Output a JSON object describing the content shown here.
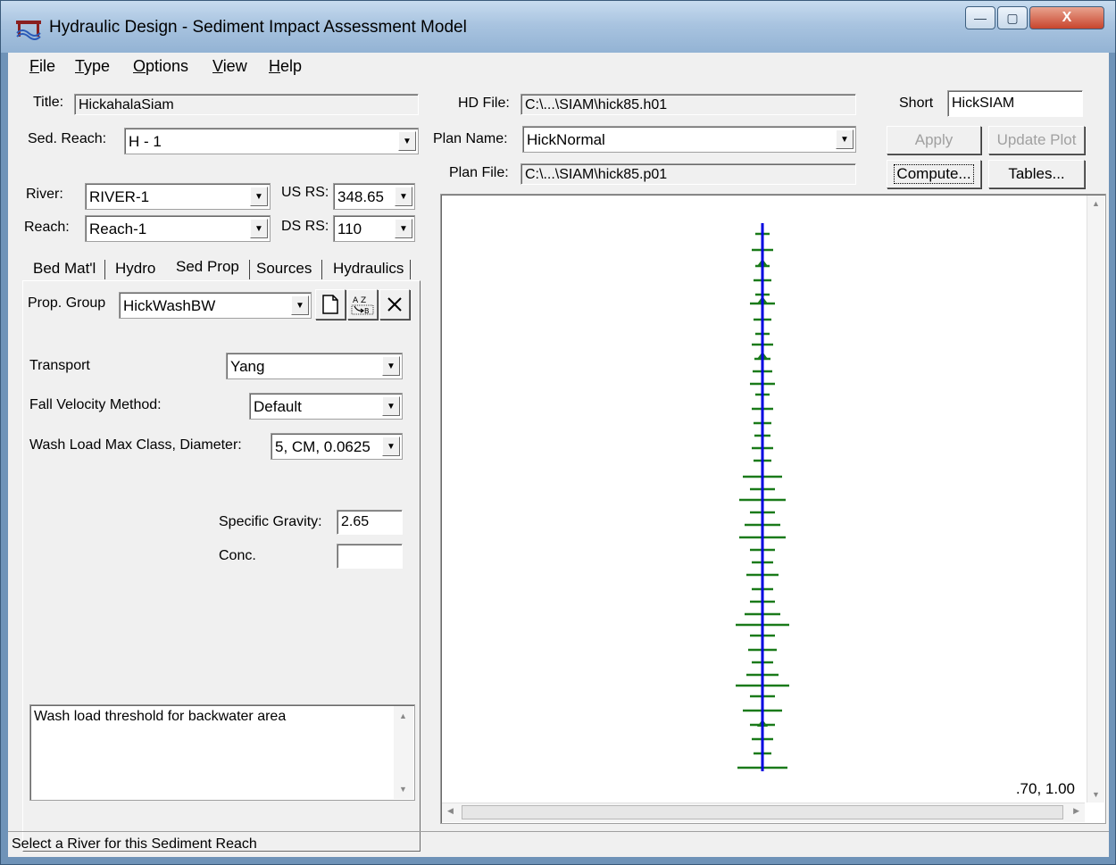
{
  "window": {
    "title": "Hydraulic Design - Sediment Impact Assessment Model",
    "minimize_label": "—",
    "maximize_label": "▢",
    "close_label": "X"
  },
  "menu": {
    "file": {
      "key": "F",
      "rest": "ile"
    },
    "type": {
      "key": "T",
      "rest": "ype"
    },
    "options": {
      "key": "O",
      "rest": "ptions"
    },
    "view": {
      "key": "V",
      "rest": "iew"
    },
    "help": {
      "key": "H",
      "rest": "elp"
    }
  },
  "form": {
    "title_label": "Title:",
    "title_value": "HickahalaSiam",
    "sed_reach_label": "Sed. Reach:",
    "sed_reach_value": "H - 1",
    "river_label": "River:",
    "river_value": "RIVER-1",
    "reach_label": "Reach:",
    "reach_value": "Reach-1",
    "us_rs_label": "US RS:",
    "us_rs_value": "348.65",
    "ds_rs_label": "DS RS:",
    "ds_rs_value": "110",
    "hd_file_label": "HD File:",
    "hd_file_value": "C:\\...\\SIAM\\hick85.h01",
    "plan_name_label": "Plan Name:",
    "plan_name_value": "HickNormal",
    "plan_file_label": "Plan File:",
    "plan_file_value": "C:\\...\\SIAM\\hick85.p01",
    "short_label": "Short",
    "short_value": "HickSIAM"
  },
  "buttons": {
    "apply": "Apply",
    "update_plot": "Update Plot",
    "compute": "Compute...",
    "tables": "Tables..."
  },
  "tabs": [
    "Bed Mat'l",
    "Hydro",
    "Sed Prop",
    "Sources",
    "Hydraulics"
  ],
  "active_tab": "Sed Prop",
  "sed_prop": {
    "prop_group_label": "Prop. Group",
    "prop_group_value": "HickWashBW",
    "transport_label": "Transport",
    "transport_value": "Yang",
    "fall_velocity_label": "Fall Velocity Method:",
    "fall_velocity_value": "Default",
    "wash_load_label": "Wash Load Max Class, Diameter:",
    "wash_load_value": "5, CM, 0.0625",
    "specific_gravity_label": "Specific Gravity:",
    "specific_gravity_value": "2.65",
    "conc_label": "Conc.",
    "conc_value": "",
    "description": "Wash load threshold for backwater area"
  },
  "plot": {
    "coord_readout": ".70, 1.00",
    "river_color": "#0000e0",
    "section_color": "#1a7a1a"
  },
  "status": "Select a River for this Sediment Reach"
}
